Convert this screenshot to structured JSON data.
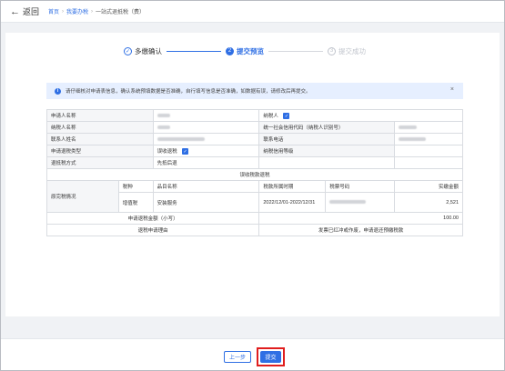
{
  "header": {
    "back_label": "返回",
    "breadcrumb": [
      "首页",
      "我要办税",
      "一站式退抵税（费）"
    ]
  },
  "steps": [
    {
      "num": "✓",
      "label": "多缴确认",
      "state": "done"
    },
    {
      "num": "2",
      "label": "提交预览",
      "state": "active"
    },
    {
      "num": "3",
      "label": "提交成功",
      "state": "todo"
    }
  ],
  "alert": {
    "text": "请仔细核对申请表信息，确认系统预填数据是否准确，自行填写信息是否准确，如数据有误，请修改后再提交。",
    "close": "×"
  },
  "form": {
    "applicant_label": "申请人名称",
    "taxpayer_label": "纳税人",
    "taxpayer_name_label": "纳税人名称",
    "credit_code_label": "统一社会信用代码（纳税人识别号）",
    "contact_label": "联系人姓名",
    "phone_label": "联系电话",
    "refund_type_label": "申请退税类型",
    "refund_type_value": "误收退税",
    "credit_level_label": "纳税信用等级",
    "refund_method_label": "退抵税方式",
    "refund_method_value": "先抵后退",
    "section_title": "误收税款退税",
    "origin_label": "原完税情况",
    "col_tax": "税种",
    "col_item": "品目名称",
    "col_period": "税款所属时期",
    "col_ticket": "税票号码",
    "col_amount": "实缴金额",
    "row_tax": "增值税",
    "row_item": "安装服务",
    "row_period": "2022/12/01-2022/12/31",
    "row_amount": "2,521",
    "total_label": "申请退税金额（小写）",
    "total_value": "100.00",
    "reason_label": "退税申请理由",
    "reason_value": "发票已红冲或作废，申请退还预缴税款"
  },
  "footer": {
    "prev_label": "上一步",
    "submit_label": "提交"
  },
  "colors": {
    "accent": "#2f6fe4",
    "highlight": "#e01e1e"
  }
}
